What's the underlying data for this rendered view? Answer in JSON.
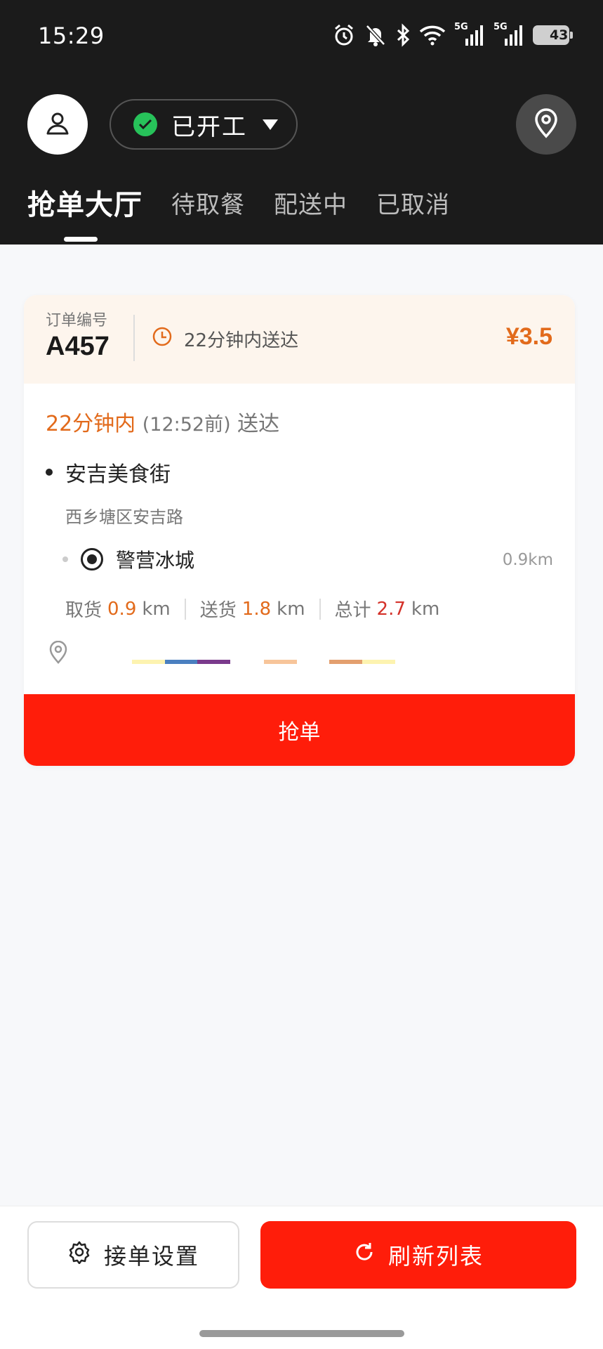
{
  "status_bar": {
    "time": "15:29",
    "network_label_1": "5G",
    "network_label_2": "5G",
    "battery": "43",
    "battery_level": 0.43
  },
  "header": {
    "work_status": "已开工",
    "tabs": [
      {
        "label": "抢单大厅",
        "active": true
      },
      {
        "label": "待取餐",
        "active": false
      },
      {
        "label": "配送中",
        "active": false
      },
      {
        "label": "已取消",
        "active": false
      }
    ]
  },
  "order": {
    "order_no_label": "订单编号",
    "order_no": "A457",
    "deliver_within": "22分钟内送达",
    "price": "¥3.5",
    "deadline_highlight": "22分钟内",
    "deadline_time": "(12:52前)",
    "deadline_suffix": "送达",
    "pickup_name": "安吉美食街",
    "pickup_address": "西乡塘区安吉路",
    "destination_name": "警营冰城",
    "destination_distance": "0.9km",
    "pickup_label": "取货",
    "pickup_km": "0.9",
    "deliver_label": "送货",
    "deliver_km": "1.8",
    "total_label": "总计",
    "total_km": "2.7",
    "unit": "km",
    "grab_button": "抢单"
  },
  "bottom": {
    "settings_button": "接单设置",
    "refresh_button": "刷新列表"
  },
  "colors": {
    "accent_red": "#ff1d0a",
    "accent_orange": "#e26a1b",
    "success_green": "#27c25a"
  }
}
